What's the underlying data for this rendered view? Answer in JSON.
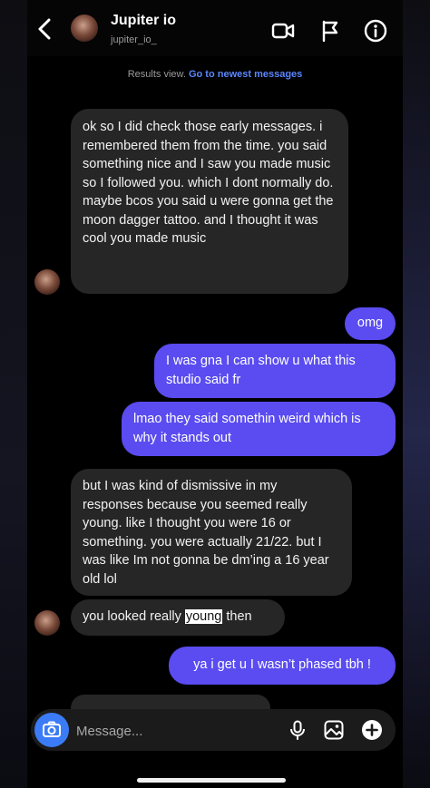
{
  "header": {
    "name": "Jupiter io",
    "username": "jupiter_io_"
  },
  "results_bar": {
    "text": "Results view.",
    "link": "Go to newest messages"
  },
  "messages": [
    {
      "from": "them",
      "text": "ok so I did check those early messages.  i remembered them from the time.  you said something nice and I saw you made music so I followed you.  which I dont normally do.  maybe bcos you said u were gonna get the moon dagger tattoo. and I thought it was cool you made music"
    },
    {
      "from": "me",
      "text": "omg"
    },
    {
      "from": "me",
      "text": "I was gna I can show u what this studio said fr"
    },
    {
      "from": "me",
      "text": "lmao they said somethin weird which is why it stands out"
    },
    {
      "from": "them",
      "text": "but I was kind of dismissive in my responses because you seemed really young.  like I thought you were 16 or something.  you were actually 21/22. but I was like Im not gonna be dm’ing a 16 year old lol"
    },
    {
      "from": "them",
      "text_before": "you looked really ",
      "highlight": "young",
      "text_after": " then"
    },
    {
      "from": "me",
      "text": "ya i get u I wasn’t phased tbh !"
    }
  ],
  "composer": {
    "placeholder": "Message..."
  },
  "icons": {
    "back": "chevron-left-icon",
    "video": "video-call-icon",
    "flag": "flag-icon",
    "info": "info-icon",
    "camera": "camera-icon",
    "mic": "microphone-icon",
    "gallery": "gallery-icon",
    "add": "plus-circle-icon"
  },
  "colors": {
    "sent_bubble": "#5a4cf0",
    "received_bubble": "#262626",
    "link": "#5b86ff",
    "camera_button": "#3b7cf6"
  }
}
